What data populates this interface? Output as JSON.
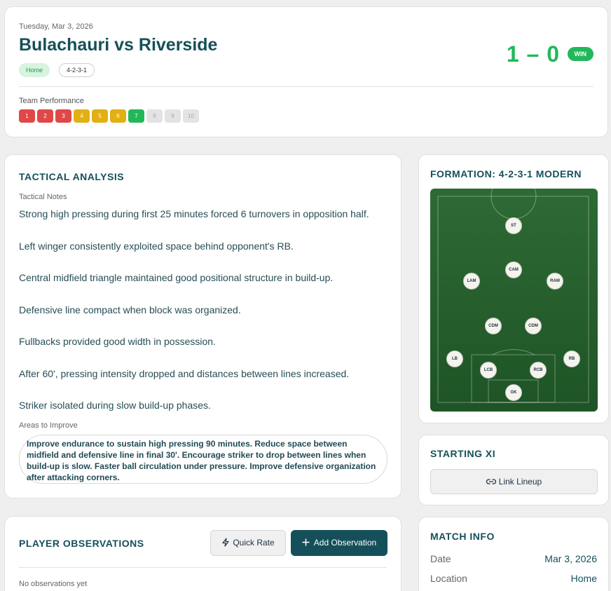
{
  "header": {
    "date": "Tuesday, Mar 3, 2026",
    "title": "Bulachauri vs Riverside",
    "venue": "Home",
    "formation": "4-2-3-1",
    "score": "1 – 0",
    "result": "WIN",
    "performance_label": "Team Performance",
    "performance_selected": 7,
    "performance_scale": [
      "1",
      "2",
      "3",
      "4",
      "5",
      "6",
      "7",
      "8",
      "9",
      "10"
    ],
    "performance_colors": [
      "#e04848",
      "#e04848",
      "#e04848",
      "#e2b012",
      "#e2b012",
      "#e2b012",
      "#22b85a",
      "#e3e3e3",
      "#e3e3e3",
      "#e3e3e3"
    ]
  },
  "tactical": {
    "title": "TACTICAL ANALYSIS",
    "notes_label": "Tactical Notes",
    "notes": [
      "Strong high pressing during first 25 minutes forced 6 turnovers in opposition half.",
      "Left winger consistently exploited space behind opponent's RB.",
      "Central midfield triangle maintained good positional structure in build-up.",
      "Defensive line compact when block was organized.",
      "Fullbacks provided good width in possession.",
      "After 60', pressing intensity dropped and distances between lines increased.",
      "Striker isolated during slow build-up phases."
    ],
    "improve_label": "Areas to Improve",
    "improve_text": "Improve endurance to sustain high pressing 90 minutes. Reduce space between midfield and defensive line in final 30'. Encourage striker to drop between lines when build-up is slow. Faster ball circulation under pressure. Improve defensive organization after attacking corners."
  },
  "formation_panel": {
    "title": "FORMATION: 4-2-3-1 MODERN",
    "players": [
      "ST",
      "LAM",
      "CAM",
      "RAM",
      "CDM",
      "CDM",
      "LB",
      "LCB",
      "RCB",
      "RB",
      "GK"
    ]
  },
  "starting_xi": {
    "title": "STARTING XI",
    "link_label": "Link Lineup"
  },
  "observations": {
    "title": "PLAYER OBSERVATIONS",
    "quick_rate_label": "Quick Rate",
    "add_label": "Add Observation",
    "empty_text": "No observations yet"
  },
  "match_info": {
    "title": "MATCH INFO",
    "rows": [
      {
        "key": "Date",
        "value": "Mar 3, 2026"
      },
      {
        "key": "Location",
        "value": "Home"
      }
    ]
  }
}
